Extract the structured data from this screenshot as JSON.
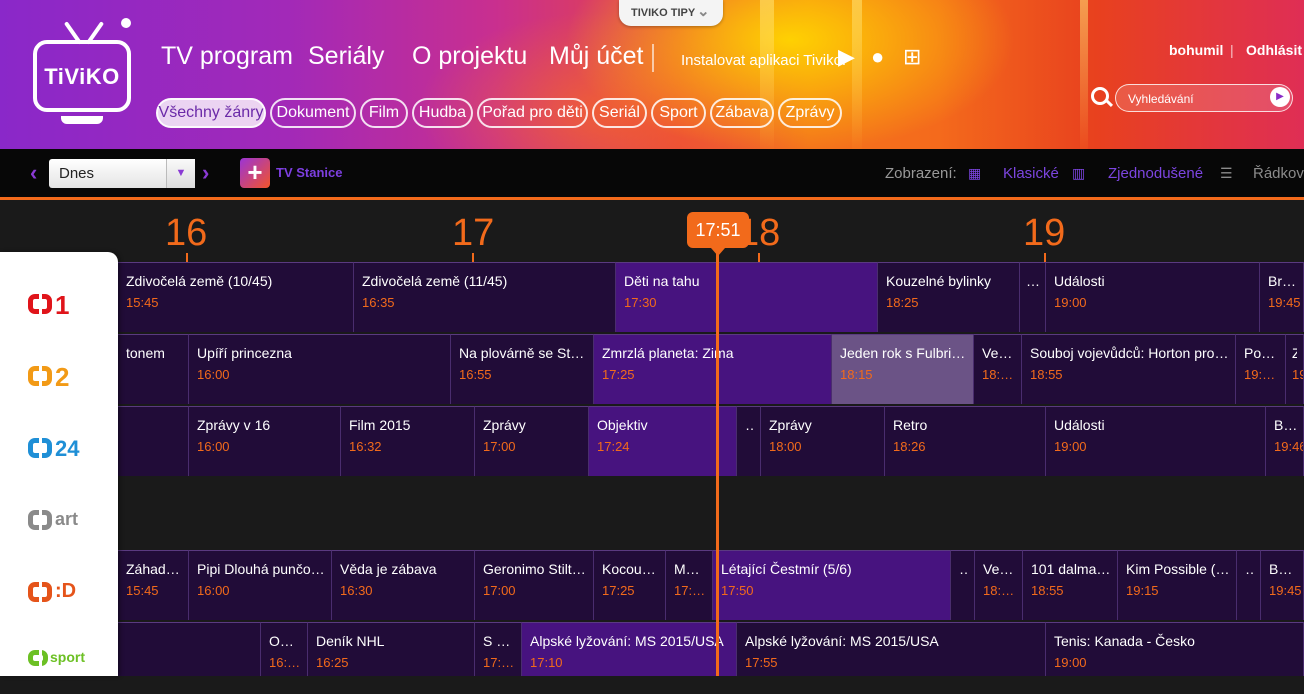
{
  "header": {
    "logo_text": "TiViKO",
    "tips_label": "TIVIKO TIPY",
    "nav": [
      "TV program",
      "Seriály",
      "O projektu",
      "Můj účet"
    ],
    "install_label": "Instalovat aplikaci Tiviko:",
    "user_name": "bohumil",
    "logout_label": "Odhlásit",
    "search_placeholder": "Vyhledávání",
    "genres": [
      "Všechny žánry",
      "Dokument",
      "Film",
      "Hudba",
      "Pořad pro děti",
      "Seriál",
      "Sport",
      "Zábava",
      "Zprávy"
    ]
  },
  "toolbar": {
    "day_value": "Dnes",
    "stanice_label": "TV Stanice",
    "view_label": "Zobrazení:",
    "view_options": [
      "Klasické",
      "Zjednodušené",
      "Řádkové"
    ]
  },
  "timeline": {
    "hours": [
      "16",
      "17",
      "18",
      "19"
    ],
    "now": "17:51"
  },
  "channels": [
    {
      "name": "ČT1",
      "mark": "1",
      "color": "#e0141a"
    },
    {
      "name": "ČT2",
      "mark": "2",
      "color": "#f29a16"
    },
    {
      "name": "ČT24",
      "mark": "24",
      "color": "#1f8fd6"
    },
    {
      "name": "ČT art",
      "mark": "art",
      "color": "#8a8a8a"
    },
    {
      "name": "ČT :D",
      "mark": ":D",
      "color": "#e5541a"
    },
    {
      "name": "ČT sport",
      "mark": "sport",
      "color": "#6cc024"
    }
  ],
  "rows": {
    "ct1": [
      {
        "title": "Zdivočelá země (10/45)",
        "time": "15:45"
      },
      {
        "title": "Zdivočelá země (11/45)",
        "time": "16:35"
      },
      {
        "title": "Děti na tahu",
        "time": "17:30"
      },
      {
        "title": "Kouzelné bylinky",
        "time": "18:25"
      },
      {
        "title": "…",
        "time": ""
      },
      {
        "title": "Události",
        "time": "19:00"
      },
      {
        "title": "Bran…",
        "time": "19:45"
      }
    ],
    "ct2": [
      {
        "title": "tonem",
        "time": ""
      },
      {
        "title": "Upíří princezna",
        "time": "16:00"
      },
      {
        "title": "Na plovárně se Stev…",
        "time": "16:55"
      },
      {
        "title": "Zmrzlá planeta: Zima",
        "time": "17:25"
      },
      {
        "title": "Jeden rok s Fulbrigh…",
        "time": "18:15"
      },
      {
        "title": "Več…",
        "time": "18:…"
      },
      {
        "title": "Souboj vojevůdců: Horton proti …",
        "time": "18:55"
      },
      {
        "title": "Pos…",
        "time": "19:…"
      },
      {
        "title": "Zp…",
        "time": "19:…"
      }
    ],
    "ct24": [
      {
        "title": "Zprávy v 16",
        "time": "16:00"
      },
      {
        "title": "Film 2015",
        "time": "16:32"
      },
      {
        "title": "Zprávy",
        "time": "17:00"
      },
      {
        "title": "Objektiv",
        "time": "17:24"
      },
      {
        "title": "…",
        "time": ""
      },
      {
        "title": "Zprávy",
        "time": "18:00"
      },
      {
        "title": "Retro",
        "time": "18:26"
      },
      {
        "title": "Události",
        "time": "19:00"
      },
      {
        "title": "Brank…",
        "time": "19:46"
      }
    ],
    "ctd": [
      {
        "title": "Záhada …",
        "time": "15:45"
      },
      {
        "title": "Pipi Dlouhá punčoc…",
        "time": "16:00"
      },
      {
        "title": "Věda je zábava",
        "time": "16:30"
      },
      {
        "title": "Geronimo Stilto…",
        "time": "17:00"
      },
      {
        "title": "Kocour …",
        "time": "17:25"
      },
      {
        "title": "Mé…",
        "time": "17:…"
      },
      {
        "title": "Létající Čestmír (5/6)",
        "time": "17:50"
      },
      {
        "title": "…",
        "time": ""
      },
      {
        "title": "Več…",
        "time": "18:…"
      },
      {
        "title": "101 dalmati…",
        "time": "18:55"
      },
      {
        "title": "Kim Possible (8…",
        "time": "19:15"
      },
      {
        "title": "…",
        "time": ""
      },
      {
        "title": "Bob a …",
        "time": "19:45"
      }
    ],
    "sport": [
      {
        "title": "Ob…",
        "time": "16:…"
      },
      {
        "title": "Deník NHL",
        "time": "16:25"
      },
      {
        "title": "S Č…",
        "time": "17:…"
      },
      {
        "title": "Alpské lyžování: MS 2015/USA",
        "time": "17:10"
      },
      {
        "title": "Alpské lyžování: MS 2015/USA",
        "time": "17:55"
      },
      {
        "title": "Tenis: Kanada - Česko",
        "time": "19:00"
      }
    ]
  }
}
